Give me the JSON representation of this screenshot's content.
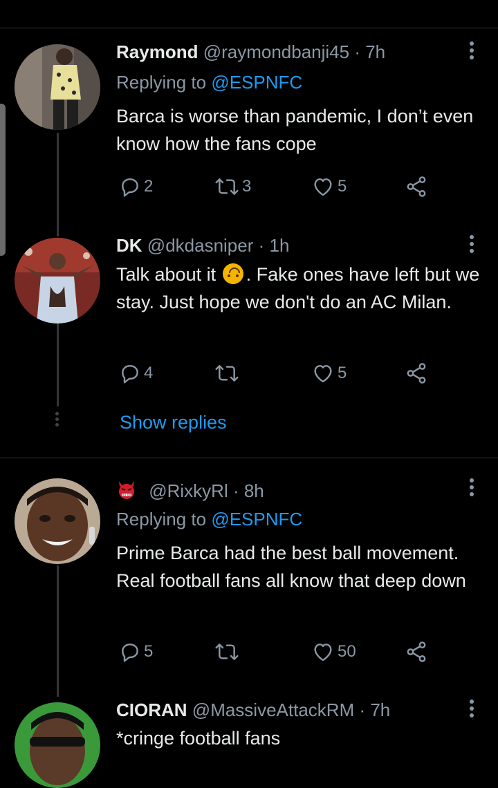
{
  "tweets": [
    {
      "name": "Raymond",
      "handle": "@raymondbanji45",
      "time": "· 7h",
      "replying_prefix": "Replying to ",
      "replying_to": "@ESPNFC",
      "text": "Barca is worse than pandemic, I don’t even know how the fans cope",
      "replies": "2",
      "retweets": "3",
      "likes": "5"
    },
    {
      "name": "DK",
      "handle": "@dkdasniper",
      "time": "· 1h",
      "text_before_emoji": "Talk about it ",
      "emoji": "upside-down-face",
      "text_after_emoji": ". Fake ones have left but we stay. Just hope we don't do an AC Milan.",
      "replies": "4",
      "retweets": "",
      "likes": "5",
      "show_replies": "Show replies"
    },
    {
      "name_icon": "devil-emoji",
      "handle": "@RixkyRl",
      "time": "· 8h",
      "replying_prefix": "Replying to ",
      "replying_to": "@ESPNFC",
      "text": "Prime Barca had the best ball movement. Real football fans all know that deep down",
      "replies": "5",
      "retweets": "",
      "likes": "50"
    },
    {
      "name": "CIORAN",
      "handle": "@MassiveAttackRM",
      "time": "· 7h",
      "text": "*cringe football fans"
    }
  ],
  "colors": {
    "background": "#000000",
    "text": "#e7e9ea",
    "secondary": "#8b98a5",
    "link": "#1d9bf0",
    "divider": "#2f3336"
  }
}
